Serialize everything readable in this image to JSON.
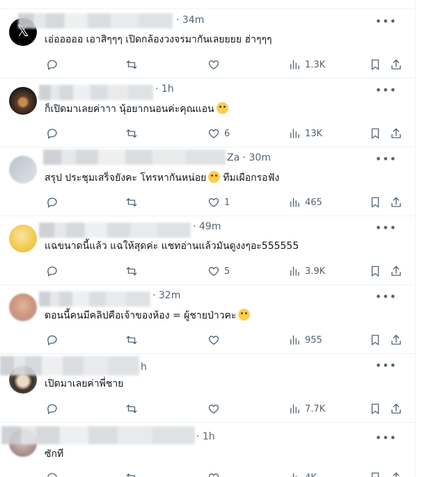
{
  "colors": {
    "text": "#0f1419",
    "secondary": "#536471",
    "divider": "#eff3f4"
  },
  "tweets": [
    {
      "time": "· 34m",
      "text": "เอ่อออออ เอาสิๆๆๆ เปิดกล้องวงจรมากันเลยยยย ฮ่าๆๆๆ",
      "emoji": "",
      "likes": "",
      "views": "1.3K"
    },
    {
      "time": "· 1h",
      "text": "ก็เปิดมาเลยค่าาา นุ้อยากนอนค่ะคุณแอน",
      "emoji": "😂",
      "likes": "6",
      "views": "13K"
    },
    {
      "time": "Za · 30m",
      "text": "สรุป ประชุมเสร็จยังคะ โทรหากันหน่อย",
      "text2": "ทีมเผือกรอฟัง",
      "emoji": "😆",
      "likes": "1",
      "views": "465"
    },
    {
      "time": "· 49m",
      "text": "แฉขนาดนี้แล้ว แฉให้สุดค่ะ แชทอ่านแล้วมันดูงงๆอะ555555",
      "emoji": "",
      "likes": "5",
      "views": "3.9K"
    },
    {
      "time": "· 32m",
      "text": "ตอนนี้คนมีคลิปคือเจ้าของห้อง = ผู้ชายป่าวคะ",
      "emoji": "😗",
      "likes": "",
      "views": "955"
    },
    {
      "time": "h",
      "text": "เปิดมาเลยค่าพี่ชาย",
      "emoji": "",
      "likes": "",
      "views": "7.7K"
    },
    {
      "time": "· 1h",
      "text": "ซักที",
      "emoji": "",
      "likes": "",
      "views": "4K"
    }
  ],
  "icons": {
    "reply": "reply-icon",
    "retweet": "retweet-icon",
    "like": "heart-icon",
    "views": "views-icon",
    "bookmark": "bookmark-icon",
    "share": "share-icon",
    "more": "more-icon"
  },
  "more_label": "•••"
}
